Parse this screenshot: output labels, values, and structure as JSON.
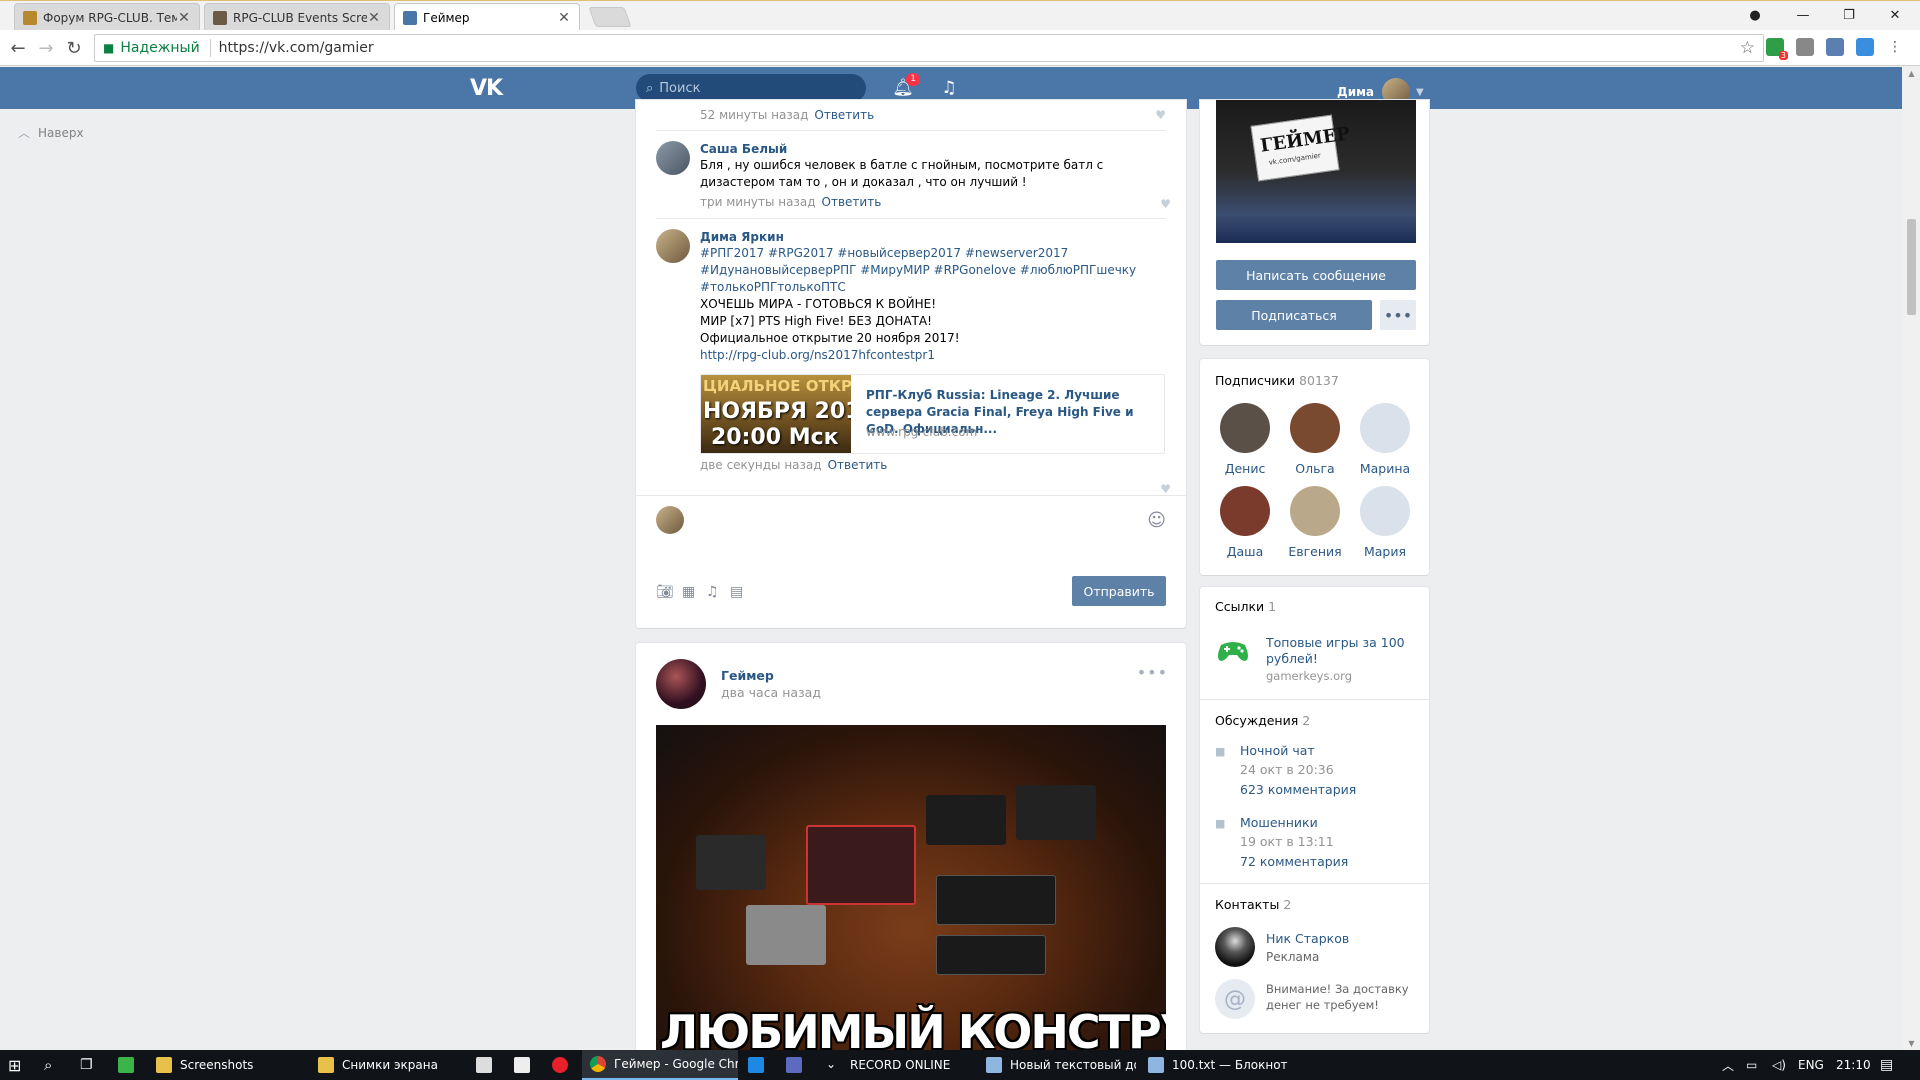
{
  "browser": {
    "tabs": [
      {
        "label": "Форум RPG-CLUB. Тема",
        "active": false
      },
      {
        "label": "RPG-CLUB Events Screen",
        "active": false
      },
      {
        "label": "Геймер",
        "active": true
      }
    ],
    "secure_label": "Надежный",
    "url": "https://vk.com/gamier",
    "ext_badge": "3"
  },
  "vk_header": {
    "logo": "VK",
    "search_placeholder": "Поиск",
    "notification_count": "1",
    "user_name": "Дима"
  },
  "left_nav": {
    "to_top": "Наверх"
  },
  "comments": {
    "first_meta_time": "52 минуты назад",
    "reply_label": "Ответить",
    "items": [
      {
        "author": "Саша Белый",
        "text": "Бля , ну ошибся человек в батле с гнойным, посмотрите батл с дизастером там то , он и доказал , что он лучший !",
        "time": "три минуты назад"
      },
      {
        "author": "Дима Яркин",
        "hashtags": "#РПГ2017 #RPG2017 #новыйсервер2017 #newserver2017 #ИдунановыйсерверРПГ #МируМИР #RPGonelove #люблюРПГшечку #толькоРПГтолькоПТС",
        "line1": "ХОЧЕШЬ МИРА - ГОТОВЬСЯ К ВОЙНЕ!",
        "line2": "МИР [x7] PTS High Five! БЕЗ ДОНАТА!",
        "line3": "Официальное открытие 20 ноября 2017!",
        "link": "http://rpg-club.org/ns2017hfcontestpr1",
        "snippet": {
          "img_line1": "ЦИАЛЬНОЕ ОТКРЫ",
          "img_line2": "НОЯБРЯ 201",
          "img_line3": "20:00 Мск",
          "title": "РПГ-Клуб Russia: Lineage 2. Лучшие сервера Gracia Final, Freya High Five и GoD. Официальн...",
          "domain": "www.rpg-club.com"
        },
        "time": "две секунды назад"
      }
    ],
    "send_button": "Отправить"
  },
  "post": {
    "author": "Геймер",
    "time": "два часа назад",
    "image_caption": "ЛЮБИМЫЙ КОНСТРУКТОР"
  },
  "profile": {
    "cover_sign": "ГЕЙМЕР",
    "cover_sub": "vk.com/gamier",
    "message_button": "Написать сообщение",
    "subscribe_button": "Подписаться"
  },
  "subscribers": {
    "title": "Подписчики",
    "count": "80137",
    "people": [
      {
        "name": "Денис",
        "color": "#5b5048"
      },
      {
        "name": "Ольга",
        "color": "#7a4a30"
      },
      {
        "name": "Марина",
        "color": "#d9e1ea"
      },
      {
        "name": "Даша",
        "color": "#7a3a2c"
      },
      {
        "name": "Евгения",
        "color": "#b9a88a"
      },
      {
        "name": "Мария",
        "color": "#d9e1ea"
      }
    ]
  },
  "links": {
    "title": "Ссылки",
    "count": "1",
    "items": [
      {
        "title": "Топовые игры за 100 рублей!",
        "domain": "gamerkeys.org"
      }
    ]
  },
  "discussions": {
    "title": "Обсуждения",
    "count": "2",
    "items": [
      {
        "title": "Ночной чат",
        "date": "24 окт в 20:36",
        "comments": "623 комментария"
      },
      {
        "title": "Мошенники",
        "date": "19 окт в 13:11",
        "comments": "72 комментария"
      }
    ]
  },
  "contacts": {
    "title": "Контакты",
    "count": "2",
    "items": [
      {
        "name": "Ник Старков",
        "role": "Реклама"
      },
      {
        "note": "Внимание! За доставку денег не требуем!"
      }
    ]
  },
  "taskbar": {
    "items": [
      {
        "label": "Screenshots"
      },
      {
        "label": "Снимки экрана"
      },
      {
        "label": "Геймер - Google Chr..."
      },
      {
        "label": "RECORD ONLINE"
      },
      {
        "label": "Новый текстовый до..."
      },
      {
        "label": "100.txt — Блокнот"
      }
    ],
    "lang": "ENG",
    "clock": "21:10"
  },
  "colors": {
    "vk_blue": "#4a76a8",
    "link_blue": "#2a5885",
    "button_blue": "#5e81a8",
    "page_bg": "#edeef0"
  }
}
